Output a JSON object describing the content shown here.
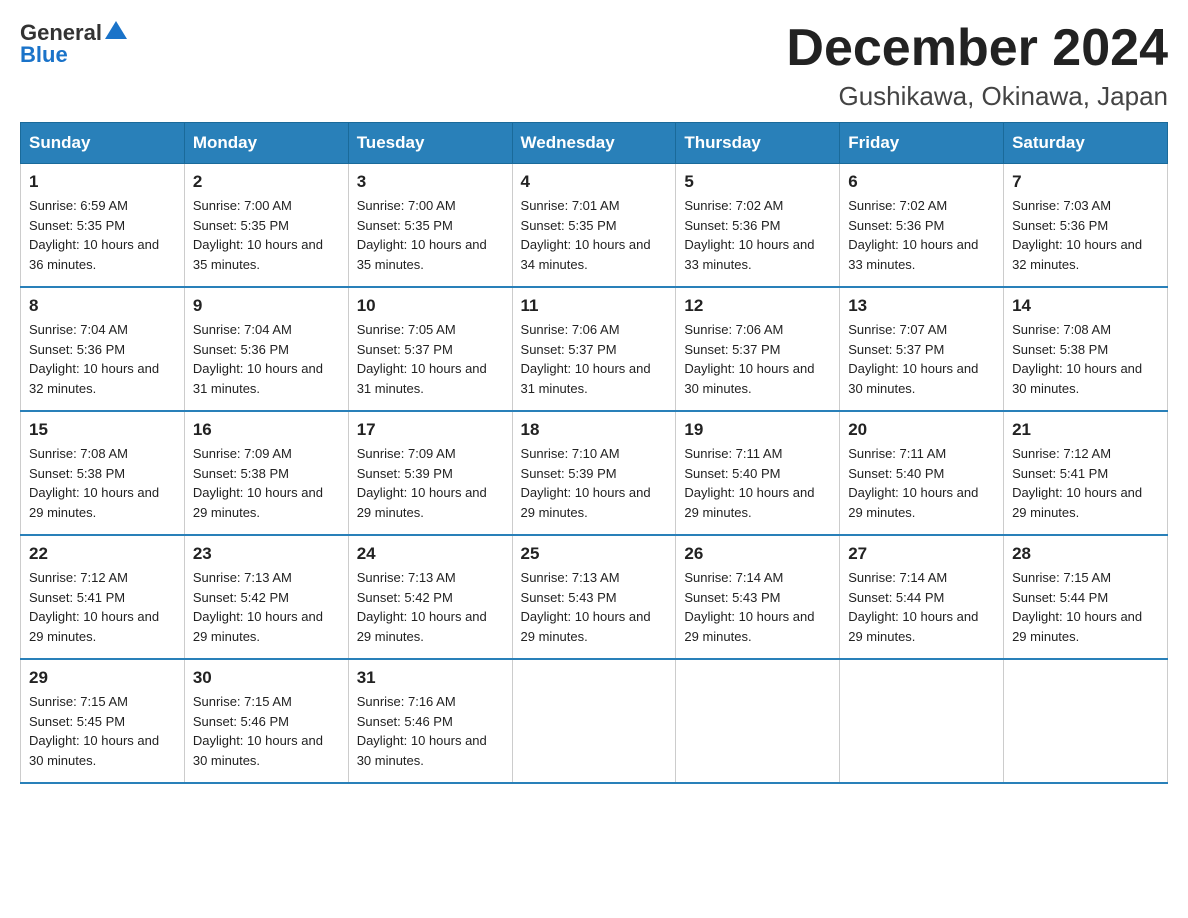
{
  "logo": {
    "text_general": "General",
    "text_blue": "Blue"
  },
  "calendar": {
    "title": "December 2024",
    "subtitle": "Gushikawa, Okinawa, Japan"
  },
  "headers": [
    "Sunday",
    "Monday",
    "Tuesday",
    "Wednesday",
    "Thursday",
    "Friday",
    "Saturday"
  ],
  "weeks": [
    [
      {
        "day": "1",
        "sunrise": "6:59 AM",
        "sunset": "5:35 PM",
        "daylight": "10 hours and 36 minutes."
      },
      {
        "day": "2",
        "sunrise": "7:00 AM",
        "sunset": "5:35 PM",
        "daylight": "10 hours and 35 minutes."
      },
      {
        "day": "3",
        "sunrise": "7:00 AM",
        "sunset": "5:35 PM",
        "daylight": "10 hours and 35 minutes."
      },
      {
        "day": "4",
        "sunrise": "7:01 AM",
        "sunset": "5:35 PM",
        "daylight": "10 hours and 34 minutes."
      },
      {
        "day": "5",
        "sunrise": "7:02 AM",
        "sunset": "5:36 PM",
        "daylight": "10 hours and 33 minutes."
      },
      {
        "day": "6",
        "sunrise": "7:02 AM",
        "sunset": "5:36 PM",
        "daylight": "10 hours and 33 minutes."
      },
      {
        "day": "7",
        "sunrise": "7:03 AM",
        "sunset": "5:36 PM",
        "daylight": "10 hours and 32 minutes."
      }
    ],
    [
      {
        "day": "8",
        "sunrise": "7:04 AM",
        "sunset": "5:36 PM",
        "daylight": "10 hours and 32 minutes."
      },
      {
        "day": "9",
        "sunrise": "7:04 AM",
        "sunset": "5:36 PM",
        "daylight": "10 hours and 31 minutes."
      },
      {
        "day": "10",
        "sunrise": "7:05 AM",
        "sunset": "5:37 PM",
        "daylight": "10 hours and 31 minutes."
      },
      {
        "day": "11",
        "sunrise": "7:06 AM",
        "sunset": "5:37 PM",
        "daylight": "10 hours and 31 minutes."
      },
      {
        "day": "12",
        "sunrise": "7:06 AM",
        "sunset": "5:37 PM",
        "daylight": "10 hours and 30 minutes."
      },
      {
        "day": "13",
        "sunrise": "7:07 AM",
        "sunset": "5:37 PM",
        "daylight": "10 hours and 30 minutes."
      },
      {
        "day": "14",
        "sunrise": "7:08 AM",
        "sunset": "5:38 PM",
        "daylight": "10 hours and 30 minutes."
      }
    ],
    [
      {
        "day": "15",
        "sunrise": "7:08 AM",
        "sunset": "5:38 PM",
        "daylight": "10 hours and 29 minutes."
      },
      {
        "day": "16",
        "sunrise": "7:09 AM",
        "sunset": "5:38 PM",
        "daylight": "10 hours and 29 minutes."
      },
      {
        "day": "17",
        "sunrise": "7:09 AM",
        "sunset": "5:39 PM",
        "daylight": "10 hours and 29 minutes."
      },
      {
        "day": "18",
        "sunrise": "7:10 AM",
        "sunset": "5:39 PM",
        "daylight": "10 hours and 29 minutes."
      },
      {
        "day": "19",
        "sunrise": "7:11 AM",
        "sunset": "5:40 PM",
        "daylight": "10 hours and 29 minutes."
      },
      {
        "day": "20",
        "sunrise": "7:11 AM",
        "sunset": "5:40 PM",
        "daylight": "10 hours and 29 minutes."
      },
      {
        "day": "21",
        "sunrise": "7:12 AM",
        "sunset": "5:41 PM",
        "daylight": "10 hours and 29 minutes."
      }
    ],
    [
      {
        "day": "22",
        "sunrise": "7:12 AM",
        "sunset": "5:41 PM",
        "daylight": "10 hours and 29 minutes."
      },
      {
        "day": "23",
        "sunrise": "7:13 AM",
        "sunset": "5:42 PM",
        "daylight": "10 hours and 29 minutes."
      },
      {
        "day": "24",
        "sunrise": "7:13 AM",
        "sunset": "5:42 PM",
        "daylight": "10 hours and 29 minutes."
      },
      {
        "day": "25",
        "sunrise": "7:13 AM",
        "sunset": "5:43 PM",
        "daylight": "10 hours and 29 minutes."
      },
      {
        "day": "26",
        "sunrise": "7:14 AM",
        "sunset": "5:43 PM",
        "daylight": "10 hours and 29 minutes."
      },
      {
        "day": "27",
        "sunrise": "7:14 AM",
        "sunset": "5:44 PM",
        "daylight": "10 hours and 29 minutes."
      },
      {
        "day": "28",
        "sunrise": "7:15 AM",
        "sunset": "5:44 PM",
        "daylight": "10 hours and 29 minutes."
      }
    ],
    [
      {
        "day": "29",
        "sunrise": "7:15 AM",
        "sunset": "5:45 PM",
        "daylight": "10 hours and 30 minutes."
      },
      {
        "day": "30",
        "sunrise": "7:15 AM",
        "sunset": "5:46 PM",
        "daylight": "10 hours and 30 minutes."
      },
      {
        "day": "31",
        "sunrise": "7:16 AM",
        "sunset": "5:46 PM",
        "daylight": "10 hours and 30 minutes."
      },
      null,
      null,
      null,
      null
    ]
  ]
}
